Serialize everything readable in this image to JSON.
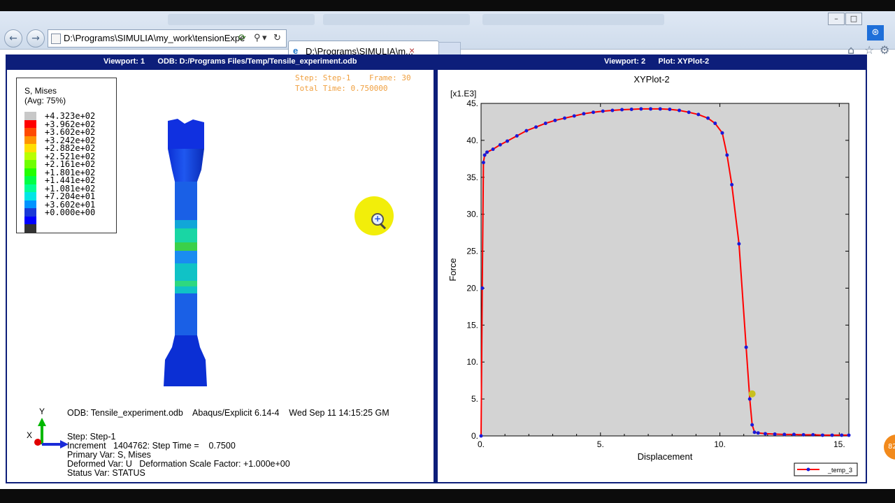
{
  "browser": {
    "address_url": "D:\\Programs\\SIMULIA\\my_work\\tensionExpe",
    "tab_title": "D:\\Programs\\SIMULIA\\m...",
    "close_tab_glyph": "×"
  },
  "viewport1": {
    "title": "Viewport: 1      ODB: D:/Programs Files/Temp/Tensile_experiment.odb",
    "legend": {
      "title": "S, Mises",
      "subtitle": "(Avg: 75%)",
      "values": [
        "+4.323e+02",
        "+3.962e+02",
        "+3.602e+02",
        "+3.242e+02",
        "+2.882e+02",
        "+2.521e+02",
        "+2.161e+02",
        "+1.801e+02",
        "+1.441e+02",
        "+1.081e+02",
        "+7.204e+01",
        "+3.602e+01",
        "+0.000e+00"
      ],
      "colors": [
        "#c8c8c8",
        "#ff0000",
        "#ff4a00",
        "#ff9400",
        "#ffde00",
        "#b8ff00",
        "#6eff00",
        "#22ff00",
        "#00ff46",
        "#00ff94",
        "#00e6e6",
        "#0094ff",
        "#1a3ad8",
        "#0000ff",
        "#333333"
      ]
    },
    "step_line": "Step: Step-1    Frame: 30",
    "time_line": "Total Time: 0.750000",
    "odb_line": "ODB: Tensile_experiment.odb    Abaqus/Explicit 6.14-4    Wed Sep 11 14:15:25 GM",
    "info_lines": [
      "Step: Step-1",
      "Increment   1404762: Step Time =    0.7500",
      "Primary Var: S, Mises",
      "Deformed Var: U   Deformation Scale Factor: +1.000e+00",
      "Status Var: STATUS"
    ],
    "triad": {
      "y": "Y",
      "x": "X"
    }
  },
  "viewport2": {
    "title": "Viewport: 2      Plot: XYPlot-2"
  },
  "chart_data": {
    "type": "line",
    "title": "XYPlot-2",
    "xlabel": "Displacement",
    "ylabel": "Force",
    "y_multiplier_label": "[x1.E3]",
    "xlim": [
      0,
      15.4
    ],
    "ylim": [
      0,
      45
    ],
    "xticks": [
      "0.",
      "5.",
      "10.",
      "15."
    ],
    "yticks": [
      "0.",
      "5.",
      "10.",
      "15.",
      "20.",
      "25.",
      "30.",
      "35.",
      "40.",
      "45."
    ],
    "background": "#d3d3d3",
    "line_color": "#ff0000",
    "marker_color": "#1a1ad8",
    "legend_position": "bottom-right",
    "series": [
      {
        "name": "_temp_3",
        "x": [
          0.0,
          0.05,
          0.1,
          0.15,
          0.25,
          0.5,
          0.8,
          1.1,
          1.5,
          1.9,
          2.3,
          2.7,
          3.1,
          3.5,
          3.9,
          4.3,
          4.7,
          5.1,
          5.5,
          5.9,
          6.3,
          6.7,
          7.1,
          7.5,
          7.9,
          8.3,
          8.7,
          9.1,
          9.5,
          9.8,
          10.1,
          10.3,
          10.5,
          10.8,
          11.1,
          11.25,
          11.35,
          11.45,
          11.6,
          11.9,
          12.3,
          12.7,
          13.1,
          13.5,
          13.9,
          14.3,
          14.7,
          15.1,
          15.4
        ],
        "y": [
          0.0,
          20.0,
          37.0,
          38.0,
          38.4,
          38.8,
          39.4,
          39.9,
          40.6,
          41.3,
          41.8,
          42.3,
          42.7,
          43.0,
          43.3,
          43.6,
          43.8,
          43.95,
          44.05,
          44.15,
          44.2,
          44.25,
          44.25,
          44.25,
          44.2,
          44.05,
          43.8,
          43.5,
          43.0,
          42.3,
          41.0,
          38.0,
          34.0,
          26.0,
          12.0,
          5.0,
          1.5,
          0.5,
          0.4,
          0.3,
          0.25,
          0.2,
          0.2,
          0.15,
          0.15,
          0.1,
          0.1,
          0.1,
          0.1
        ]
      }
    ],
    "highlight_point": {
      "x": 11.35,
      "y": 5.7
    }
  }
}
